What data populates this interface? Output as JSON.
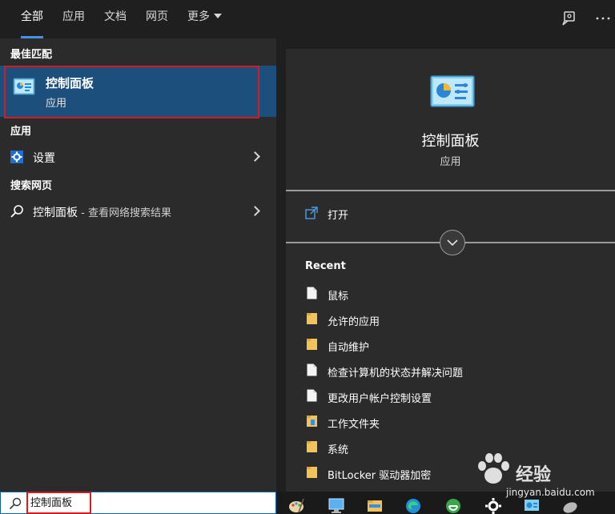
{
  "tabs": [
    {
      "label": "全部",
      "active": true
    },
    {
      "label": "应用",
      "active": false
    },
    {
      "label": "文档",
      "active": false
    },
    {
      "label": "网页",
      "active": false
    },
    {
      "label": "更多",
      "active": false
    }
  ],
  "sections": {
    "best_match": "最佳匹配",
    "apps": "应用",
    "web": "搜索网页"
  },
  "best_match": {
    "title": "控制面板",
    "subtitle": "应用"
  },
  "apps": [
    {
      "label": "设置",
      "icon": "gear-icon"
    }
  ],
  "web": {
    "label": "控制面板",
    "suffix": " - 查看网络搜索结果",
    "icon": "search-icon"
  },
  "detail": {
    "title": "控制面板",
    "subtitle": "应用",
    "open_label": "打开"
  },
  "recent": {
    "title": "Recent",
    "items": [
      {
        "label": "鼠标",
        "icon": "file-icon"
      },
      {
        "label": "允许的应用",
        "icon": "folder-icon"
      },
      {
        "label": "自动维护",
        "icon": "folder-icon"
      },
      {
        "label": "检查计算机的状态并解决问题",
        "icon": "file-icon"
      },
      {
        "label": "更改用户帐户控制设置",
        "icon": "file-icon"
      },
      {
        "label": "工作文件夹",
        "icon": "folder-icon"
      },
      {
        "label": "系统",
        "icon": "folder-icon"
      },
      {
        "label": "BitLocker 驱动器加密",
        "icon": "folder-icon"
      }
    ]
  },
  "search": {
    "value": "控制面板"
  },
  "watermark": {
    "text": "经验",
    "url": "jingyan.baidu.com"
  },
  "colors": {
    "accent": "#4a90e2",
    "selected": "#1d4f7c",
    "highlight_box": "#d71920"
  }
}
